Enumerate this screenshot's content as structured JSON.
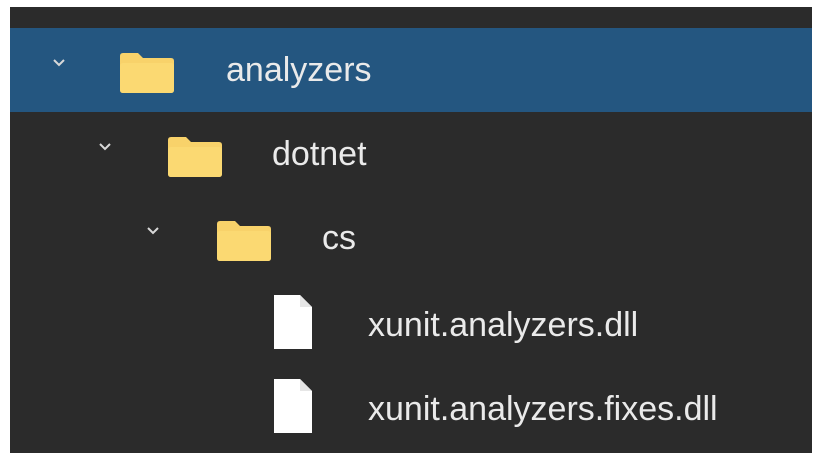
{
  "tree": {
    "items": [
      {
        "label": "analyzers",
        "type": "folder",
        "expanded": true,
        "selected": true,
        "depth": 0
      },
      {
        "label": "dotnet",
        "type": "folder",
        "expanded": true,
        "selected": false,
        "depth": 1
      },
      {
        "label": "cs",
        "type": "folder",
        "expanded": true,
        "selected": false,
        "depth": 2
      },
      {
        "label": "xunit.analyzers.dll",
        "type": "file",
        "selected": false,
        "depth": 3
      },
      {
        "label": "xunit.analyzers.fixes.dll",
        "type": "file",
        "selected": false,
        "depth": 3
      }
    ]
  },
  "colors": {
    "background": "#2b2b2b",
    "selection": "#245680",
    "folder": "#f8d26a",
    "file": "#ffffff",
    "text": "#eaeaea"
  }
}
